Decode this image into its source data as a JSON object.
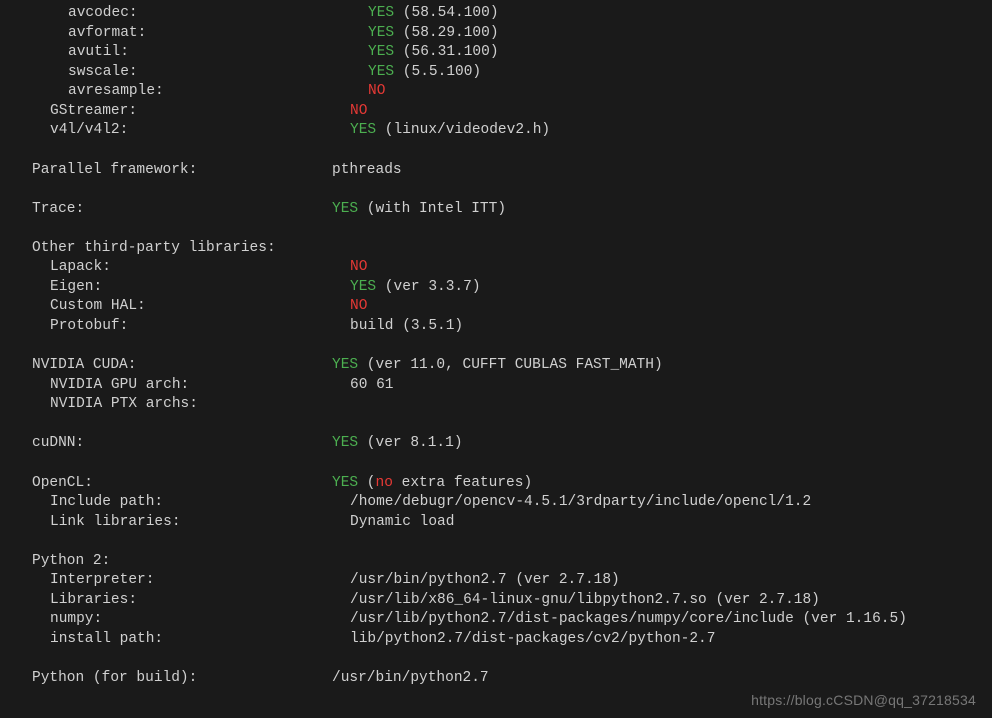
{
  "rows": [
    {
      "indent": "indent2",
      "label": "avcodec:",
      "status": "YES",
      "extra": " (58.54.100)"
    },
    {
      "indent": "indent2",
      "label": "avformat:",
      "status": "YES",
      "extra": " (58.29.100)"
    },
    {
      "indent": "indent2",
      "label": "avutil:",
      "status": "YES",
      "extra": " (56.31.100)"
    },
    {
      "indent": "indent2",
      "label": "swscale:",
      "status": "YES",
      "extra": " (5.5.100)"
    },
    {
      "indent": "indent2",
      "label": "avresample:",
      "status": "NO",
      "extra": ""
    },
    {
      "indent": "indent1",
      "label": "GStreamer:",
      "status": "NO",
      "extra": ""
    },
    {
      "indent": "indent1",
      "label": "v4l/v4l2:",
      "status": "YES",
      "extra": " (linux/videodev2.h)"
    },
    {
      "blank": true
    },
    {
      "indent": "",
      "label": "Parallel framework:",
      "status": "",
      "extra": "pthreads"
    },
    {
      "blank": true
    },
    {
      "indent": "",
      "label": "Trace:",
      "status": "YES",
      "extra": " (with Intel ITT)"
    },
    {
      "blank": true
    },
    {
      "indent": "",
      "label": "Other third-party libraries:",
      "status": "",
      "extra": ""
    },
    {
      "indent": "indent1",
      "label": "Lapack:",
      "status": "NO",
      "extra": ""
    },
    {
      "indent": "indent1",
      "label": "Eigen:",
      "status": "YES",
      "extra": " (ver 3.3.7)"
    },
    {
      "indent": "indent1",
      "label": "Custom HAL:",
      "status": "NO",
      "extra": ""
    },
    {
      "indent": "indent1",
      "label": "Protobuf:",
      "status": "",
      "extra": "build (3.5.1)"
    },
    {
      "blank": true
    },
    {
      "indent": "",
      "label": "NVIDIA CUDA:",
      "status": "YES",
      "extra": " (ver 11.0, CUFFT CUBLAS FAST_MATH)"
    },
    {
      "indent": "indent1",
      "label": "NVIDIA GPU arch:",
      "status": "",
      "extra": "60 61"
    },
    {
      "indent": "indent1",
      "label": "NVIDIA PTX archs:",
      "status": "",
      "extra": ""
    },
    {
      "blank": true
    },
    {
      "indent": "",
      "label": "cuDNN:",
      "status": "YES",
      "extra": " (ver 8.1.1)"
    },
    {
      "blank": true
    },
    {
      "indent": "",
      "label": "OpenCL:",
      "status": "YES",
      "extra_pre": " (",
      "extra_kw": "no",
      "extra_post": " extra features)"
    },
    {
      "indent": "indent1",
      "label": "Include path:",
      "status": "",
      "extra": "/home/debugr/opencv-4.5.1/3rdparty/include/opencl/1.2"
    },
    {
      "indent": "indent1",
      "label": "Link libraries:",
      "status": "",
      "extra": "Dynamic load"
    },
    {
      "blank": true
    },
    {
      "indent": "",
      "label": "Python 2:",
      "status": "",
      "extra": ""
    },
    {
      "indent": "indent1",
      "label": "Interpreter:",
      "status": "",
      "extra": "/usr/bin/python2.7 (ver 2.7.18)"
    },
    {
      "indent": "indent1",
      "label": "Libraries:",
      "status": "",
      "extra": "/usr/lib/x86_64-linux-gnu/libpython2.7.so (ver 2.7.18)"
    },
    {
      "indent": "indent1",
      "label": "numpy:",
      "status": "",
      "extra": "/usr/lib/python2.7/dist-packages/numpy/core/include (ver 1.16.5)"
    },
    {
      "indent": "indent1",
      "label": "install path:",
      "status": "",
      "extra": "lib/python2.7/dist-packages/cv2/python-2.7"
    },
    {
      "blank": true
    },
    {
      "indent": "",
      "label": "Python (for build):",
      "status": "",
      "extra": "/usr/bin/python2.7"
    }
  ],
  "watermark": "https://blog.cCSDN@qq_37218534"
}
